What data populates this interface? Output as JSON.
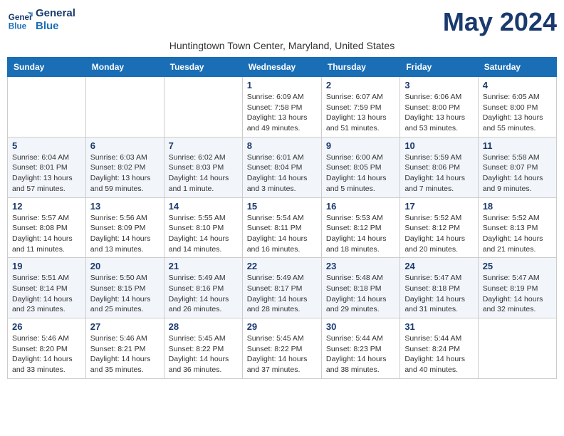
{
  "app": {
    "name_line1": "General",
    "name_line2": "Blue"
  },
  "title": "May 2024",
  "subtitle": "Huntingtown Town Center, Maryland, United States",
  "weekdays": [
    "Sunday",
    "Monday",
    "Tuesday",
    "Wednesday",
    "Thursday",
    "Friday",
    "Saturday"
  ],
  "weeks": [
    [
      {
        "day": "",
        "sunrise": "",
        "sunset": "",
        "daylight": ""
      },
      {
        "day": "",
        "sunrise": "",
        "sunset": "",
        "daylight": ""
      },
      {
        "day": "",
        "sunrise": "",
        "sunset": "",
        "daylight": ""
      },
      {
        "day": "1",
        "sunrise": "Sunrise: 6:09 AM",
        "sunset": "Sunset: 7:58 PM",
        "daylight": "Daylight: 13 hours and 49 minutes."
      },
      {
        "day": "2",
        "sunrise": "Sunrise: 6:07 AM",
        "sunset": "Sunset: 7:59 PM",
        "daylight": "Daylight: 13 hours and 51 minutes."
      },
      {
        "day": "3",
        "sunrise": "Sunrise: 6:06 AM",
        "sunset": "Sunset: 8:00 PM",
        "daylight": "Daylight: 13 hours and 53 minutes."
      },
      {
        "day": "4",
        "sunrise": "Sunrise: 6:05 AM",
        "sunset": "Sunset: 8:00 PM",
        "daylight": "Daylight: 13 hours and 55 minutes."
      }
    ],
    [
      {
        "day": "5",
        "sunrise": "Sunrise: 6:04 AM",
        "sunset": "Sunset: 8:01 PM",
        "daylight": "Daylight: 13 hours and 57 minutes."
      },
      {
        "day": "6",
        "sunrise": "Sunrise: 6:03 AM",
        "sunset": "Sunset: 8:02 PM",
        "daylight": "Daylight: 13 hours and 59 minutes."
      },
      {
        "day": "7",
        "sunrise": "Sunrise: 6:02 AM",
        "sunset": "Sunset: 8:03 PM",
        "daylight": "Daylight: 14 hours and 1 minute."
      },
      {
        "day": "8",
        "sunrise": "Sunrise: 6:01 AM",
        "sunset": "Sunset: 8:04 PM",
        "daylight": "Daylight: 14 hours and 3 minutes."
      },
      {
        "day": "9",
        "sunrise": "Sunrise: 6:00 AM",
        "sunset": "Sunset: 8:05 PM",
        "daylight": "Daylight: 14 hours and 5 minutes."
      },
      {
        "day": "10",
        "sunrise": "Sunrise: 5:59 AM",
        "sunset": "Sunset: 8:06 PM",
        "daylight": "Daylight: 14 hours and 7 minutes."
      },
      {
        "day": "11",
        "sunrise": "Sunrise: 5:58 AM",
        "sunset": "Sunset: 8:07 PM",
        "daylight": "Daylight: 14 hours and 9 minutes."
      }
    ],
    [
      {
        "day": "12",
        "sunrise": "Sunrise: 5:57 AM",
        "sunset": "Sunset: 8:08 PM",
        "daylight": "Daylight: 14 hours and 11 minutes."
      },
      {
        "day": "13",
        "sunrise": "Sunrise: 5:56 AM",
        "sunset": "Sunset: 8:09 PM",
        "daylight": "Daylight: 14 hours and 13 minutes."
      },
      {
        "day": "14",
        "sunrise": "Sunrise: 5:55 AM",
        "sunset": "Sunset: 8:10 PM",
        "daylight": "Daylight: 14 hours and 14 minutes."
      },
      {
        "day": "15",
        "sunrise": "Sunrise: 5:54 AM",
        "sunset": "Sunset: 8:11 PM",
        "daylight": "Daylight: 14 hours and 16 minutes."
      },
      {
        "day": "16",
        "sunrise": "Sunrise: 5:53 AM",
        "sunset": "Sunset: 8:12 PM",
        "daylight": "Daylight: 14 hours and 18 minutes."
      },
      {
        "day": "17",
        "sunrise": "Sunrise: 5:52 AM",
        "sunset": "Sunset: 8:12 PM",
        "daylight": "Daylight: 14 hours and 20 minutes."
      },
      {
        "day": "18",
        "sunrise": "Sunrise: 5:52 AM",
        "sunset": "Sunset: 8:13 PM",
        "daylight": "Daylight: 14 hours and 21 minutes."
      }
    ],
    [
      {
        "day": "19",
        "sunrise": "Sunrise: 5:51 AM",
        "sunset": "Sunset: 8:14 PM",
        "daylight": "Daylight: 14 hours and 23 minutes."
      },
      {
        "day": "20",
        "sunrise": "Sunrise: 5:50 AM",
        "sunset": "Sunset: 8:15 PM",
        "daylight": "Daylight: 14 hours and 25 minutes."
      },
      {
        "day": "21",
        "sunrise": "Sunrise: 5:49 AM",
        "sunset": "Sunset: 8:16 PM",
        "daylight": "Daylight: 14 hours and 26 minutes."
      },
      {
        "day": "22",
        "sunrise": "Sunrise: 5:49 AM",
        "sunset": "Sunset: 8:17 PM",
        "daylight": "Daylight: 14 hours and 28 minutes."
      },
      {
        "day": "23",
        "sunrise": "Sunrise: 5:48 AM",
        "sunset": "Sunset: 8:18 PM",
        "daylight": "Daylight: 14 hours and 29 minutes."
      },
      {
        "day": "24",
        "sunrise": "Sunrise: 5:47 AM",
        "sunset": "Sunset: 8:18 PM",
        "daylight": "Daylight: 14 hours and 31 minutes."
      },
      {
        "day": "25",
        "sunrise": "Sunrise: 5:47 AM",
        "sunset": "Sunset: 8:19 PM",
        "daylight": "Daylight: 14 hours and 32 minutes."
      }
    ],
    [
      {
        "day": "26",
        "sunrise": "Sunrise: 5:46 AM",
        "sunset": "Sunset: 8:20 PM",
        "daylight": "Daylight: 14 hours and 33 minutes."
      },
      {
        "day": "27",
        "sunrise": "Sunrise: 5:46 AM",
        "sunset": "Sunset: 8:21 PM",
        "daylight": "Daylight: 14 hours and 35 minutes."
      },
      {
        "day": "28",
        "sunrise": "Sunrise: 5:45 AM",
        "sunset": "Sunset: 8:22 PM",
        "daylight": "Daylight: 14 hours and 36 minutes."
      },
      {
        "day": "29",
        "sunrise": "Sunrise: 5:45 AM",
        "sunset": "Sunset: 8:22 PM",
        "daylight": "Daylight: 14 hours and 37 minutes."
      },
      {
        "day": "30",
        "sunrise": "Sunrise: 5:44 AM",
        "sunset": "Sunset: 8:23 PM",
        "daylight": "Daylight: 14 hours and 38 minutes."
      },
      {
        "day": "31",
        "sunrise": "Sunrise: 5:44 AM",
        "sunset": "Sunset: 8:24 PM",
        "daylight": "Daylight: 14 hours and 40 minutes."
      },
      {
        "day": "",
        "sunrise": "",
        "sunset": "",
        "daylight": ""
      }
    ]
  ]
}
